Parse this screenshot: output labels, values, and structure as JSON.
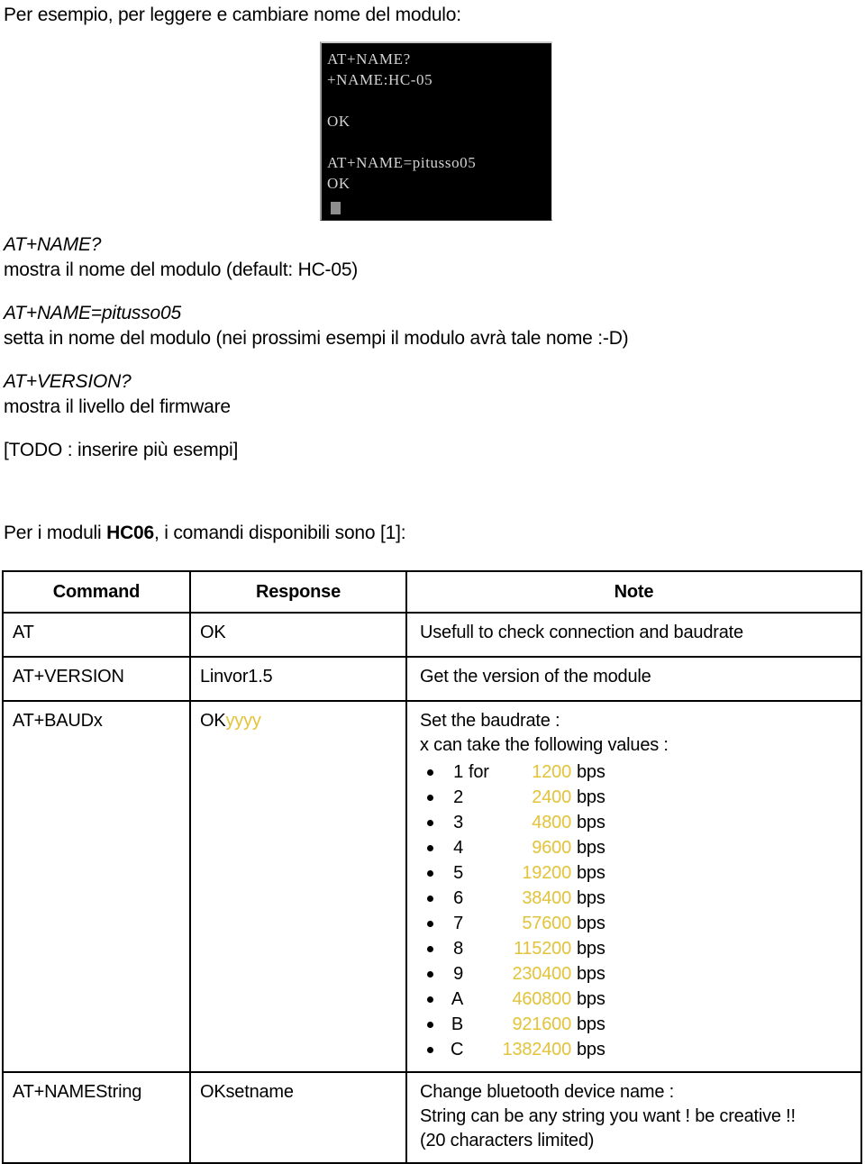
{
  "intro": {
    "text": "Per esempio, per leggere e cambiare nome del modulo:"
  },
  "terminal": {
    "name": "serial-terminal-screenshot",
    "lines": [
      "AT+NAME?",
      "+NAME:HC-05",
      "",
      "OK",
      "",
      "AT+NAME=pitusso05",
      "OK"
    ]
  },
  "definitions": [
    {
      "command": "AT+NAME?",
      "description": "mostra il nome del modulo  (default: HC-05)"
    },
    {
      "command": "AT+NAME=pitusso05",
      "description": "setta in nome del modulo (nei prossimi esempi il modulo avrà tale nome :-D)"
    },
    {
      "command": "AT+VERSION?",
      "description": "mostra il livello del firmware"
    }
  ],
  "todo_note": "[TODO : inserire più esempi]",
  "lead_in": {
    "prefix": "Per i moduli ",
    "module": "HC06",
    "suffix": ", i comandi disponibili sono [1]:"
  },
  "table": {
    "headers": {
      "command": "Command",
      "response": "Response",
      "note": "Note"
    },
    "rows": [
      {
        "command": "AT",
        "response": "OK",
        "note": "Usefull to check connection and   baudrate"
      },
      {
        "command": "AT+VERSION",
        "response": "Linvor1.5",
        "note": "Get the version of the module"
      },
      {
        "command": "AT+BAUDx",
        "response_plain": "OK",
        "response_gold": "yyyy",
        "note_line1": "Set the baudrate :",
        "note_line2": "x can take the following values :"
      },
      {
        "command": "AT+NAMEString",
        "response": "OKsetname",
        "note_line1": "Change bluetooth device name :",
        "note_line2": "String can be any string you want ! be creative !!",
        "note_line3": "(20 characters limited)"
      }
    ]
  },
  "baudrates": [
    {
      "index": "1",
      "for": "for",
      "value": "1200",
      "unit": "bps"
    },
    {
      "index": "2",
      "for": "",
      "value": "2400",
      "unit": "bps"
    },
    {
      "index": "3",
      "for": "",
      "value": "4800",
      "unit": "bps"
    },
    {
      "index": "4",
      "for": "",
      "value": "9600",
      "unit": "bps"
    },
    {
      "index": "5",
      "for": "",
      "value": "19200",
      "unit": "bps"
    },
    {
      "index": "6",
      "for": "",
      "value": "38400",
      "unit": "bps"
    },
    {
      "index": "7",
      "for": "",
      "value": "57600",
      "unit": "bps"
    },
    {
      "index": "8",
      "for": "",
      "value": "115200",
      "unit": "bps"
    },
    {
      "index": "9",
      "for": "",
      "value": "230400",
      "unit": "bps"
    },
    {
      "index": "A",
      "for": "",
      "value": "460800",
      "unit": "bps"
    },
    {
      "index": "B",
      "for": "",
      "value": "921600",
      "unit": "bps"
    },
    {
      "index": "C",
      "for": "",
      "value": "1382400",
      "unit": "bps"
    }
  ],
  "colors": {
    "gold": "#e3c33a",
    "terminal_bg": "#000000",
    "terminal_text": "#d2d2d2",
    "text": "#000000"
  }
}
